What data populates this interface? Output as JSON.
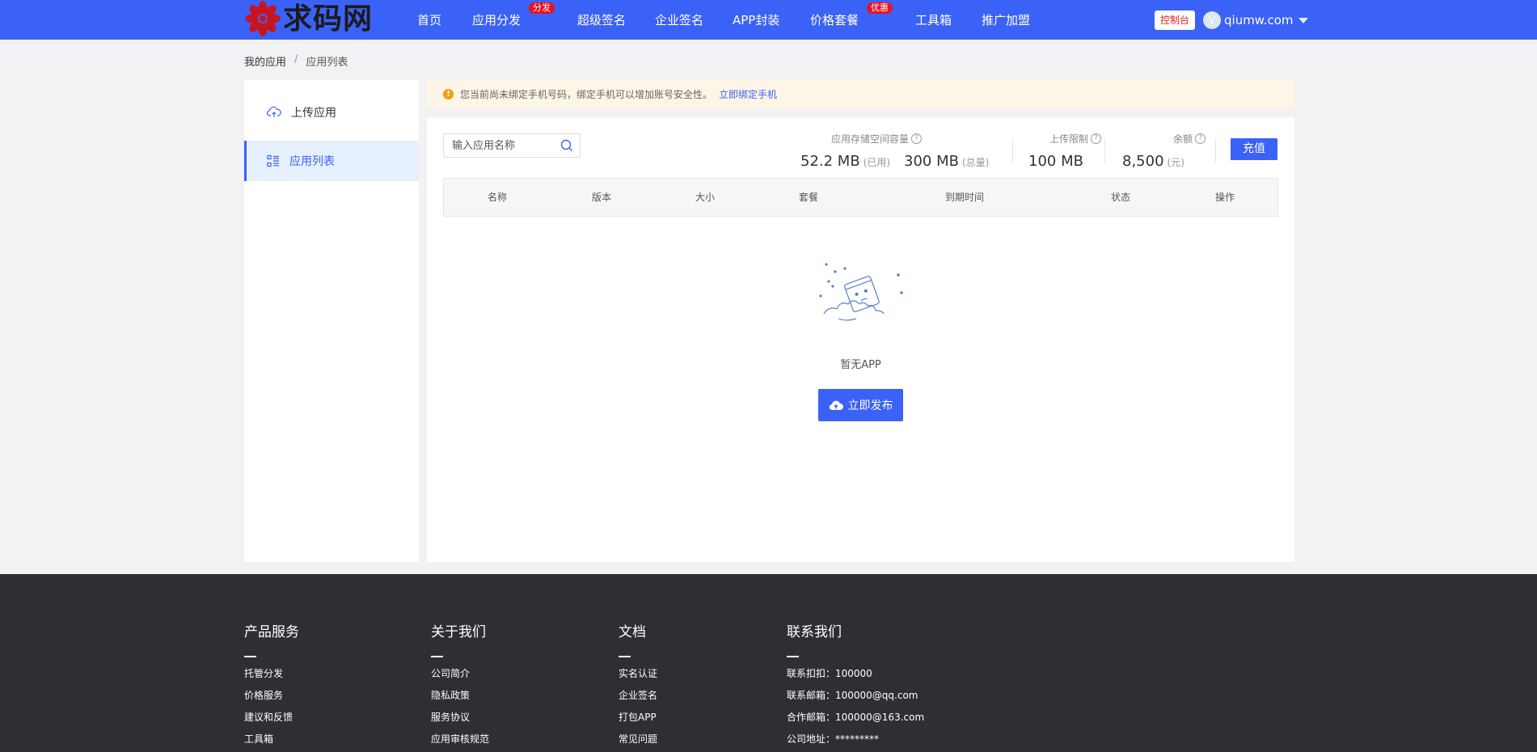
{
  "header": {
    "logo_text": "求码网",
    "nav": [
      {
        "label": "首页",
        "badge": ""
      },
      {
        "label": "应用分发",
        "badge": "分发"
      },
      {
        "label": "超级签名",
        "badge": ""
      },
      {
        "label": "企业签名",
        "badge": ""
      },
      {
        "label": "APP封装",
        "badge": ""
      },
      {
        "label": "价格套餐",
        "badge": "优惠"
      },
      {
        "label": "工具箱",
        "badge": ""
      },
      {
        "label": "推广加盟",
        "badge": ""
      }
    ],
    "console_label": "控制台",
    "user_avatar": "V",
    "username": "qiumw.com"
  },
  "breadcrumb": {
    "root": "我的应用",
    "separator": "/",
    "current": "应用列表"
  },
  "sidebar": {
    "items": [
      {
        "label": "上传应用",
        "icon": "cloud-upload-icon"
      },
      {
        "label": "应用列表",
        "icon": "list-icon"
      }
    ]
  },
  "notice": {
    "text": "您当前尚未绑定手机号码，绑定手机可以增加账号安全性。",
    "link": "立即绑定手机"
  },
  "main": {
    "search_placeholder": "输入应用名称",
    "storage": {
      "label": "应用存储空间容量",
      "used_value": "52.2 MB",
      "used_unit": "(已用)",
      "total_value": "300 MB",
      "total_unit": "(总量)"
    },
    "upload_limit": {
      "label": "上传限制",
      "value": "100 MB"
    },
    "balance": {
      "label": "余额",
      "value": "8,500",
      "unit": "(元)"
    },
    "recharge_label": "充值",
    "table_headers": [
      "名称",
      "版本",
      "大小",
      "套餐",
      "到期时间",
      "状态",
      "操作"
    ],
    "empty_text": "暂无APP",
    "publish_label": "立即发布"
  },
  "footer": {
    "columns": [
      {
        "title": "产品服务",
        "links": [
          "托管分发",
          "价格服务",
          "建议和反馈",
          "工具箱"
        ]
      },
      {
        "title": "关于我们",
        "links": [
          "公司简介",
          "隐私政策",
          "服务协议",
          "应用审核规范"
        ]
      },
      {
        "title": "文档",
        "links": [
          "实名认证",
          "企业签名",
          "打包APP",
          "常见问题"
        ]
      },
      {
        "title": "联系我们",
        "links": [
          "联系扣扣：100000",
          "联系邮箱：100000@qq.com",
          "合作邮箱：100000@163.com",
          "公司地址：*********"
        ]
      }
    ]
  },
  "colors": {
    "primary": "#3b62f6",
    "badge": "#e81123",
    "footer_bg": "#2d2f33",
    "notice_bg": "#fdf5e6"
  }
}
